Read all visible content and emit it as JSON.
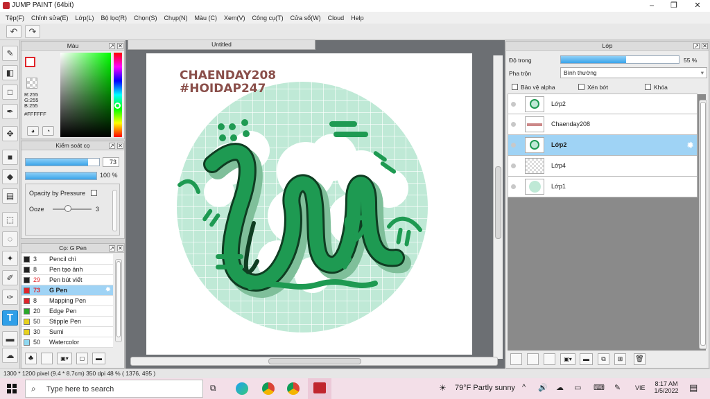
{
  "window": {
    "title": "JUMP PAINT (64bit)",
    "minimize": "–",
    "restore": "❐",
    "close": "✕"
  },
  "menu": [
    "Tệp(F)",
    "Chỉnh sửa(E)",
    "Lớp(L)",
    "Bộ lọc(R)",
    "Chọn(S)",
    "Chụp(N)",
    "Màu (C)",
    "Xem(V)",
    "Công cụ(T)",
    "Cửa sổ(W)",
    "Cloud",
    "Help"
  ],
  "color_panel": {
    "title": "Màu",
    "r": "R:255",
    "g": "G:255",
    "b": "B:255",
    "hex": "#FFFFFF",
    "accent": "#e0252b"
  },
  "brush_control": {
    "title": "Kiểm soát cọ",
    "size_value": "73",
    "opacity_value": "100 %",
    "opacity_by_pressure": "Opacity by Pressure",
    "ooze_label": "Ooze",
    "ooze_value": "3",
    "size_fraction": 0.85,
    "opacity_fraction": 1.0,
    "ooze_fraction": 0.4
  },
  "brush_list": {
    "title": "Cọ: G Pen",
    "items": [
      {
        "size": "3",
        "name": "Pencil chì",
        "color": "#222222",
        "size_color": "#222222"
      },
      {
        "size": "8",
        "name": "Pen tạo ảnh",
        "color": "#222222",
        "size_color": "#222222"
      },
      {
        "size": "29",
        "name": "Pen bút viết",
        "color": "#222222",
        "size_color": "#e0252b"
      },
      {
        "size": "73",
        "name": "G Pen",
        "color": "#e0252b",
        "size_color": "#e0252b",
        "selected": true
      },
      {
        "size": "8",
        "name": "Mapping Pen",
        "color": "#e0252b",
        "size_color": "#222222"
      },
      {
        "size": "20",
        "name": "Edge Pen",
        "color": "#2aa82a",
        "size_color": "#222222"
      },
      {
        "size": "50",
        "name": "Stipple Pen",
        "color": "#e8d21c",
        "size_color": "#222222"
      },
      {
        "size": "30",
        "name": "Sumi",
        "color": "#e8d21c",
        "size_color": "#222222"
      },
      {
        "size": "50",
        "name": "Watercolor",
        "color": "#8fd8f0",
        "size_color": "#222222"
      }
    ]
  },
  "document": {
    "tab_title": "Untitled",
    "artwork_line1": "CHAENDAY208",
    "artwork_line2": "#HOIDAP247",
    "artwork_main": "hu",
    "brand_green": "#1e9a52",
    "mint": "#bfe9d6"
  },
  "layers": {
    "title": "Lớp",
    "opacity_label": "Độ trong",
    "opacity_value": "55 %",
    "opacity_fraction": 0.55,
    "blend_label": "Pha trộn",
    "blend_value": "Bình thường",
    "protect_alpha": "Bảo vệ alpha",
    "clipping": "Xén bớt",
    "lock": "Khóa",
    "items": [
      {
        "name": "Lớp2",
        "thumb": "art"
      },
      {
        "name": "Chaenday208",
        "thumb": "text"
      },
      {
        "name": "Lớp2",
        "thumb": "art",
        "selected": true
      },
      {
        "name": "Lớp4",
        "thumb": "empty"
      },
      {
        "name": "Lớp1",
        "thumb": "circle"
      }
    ]
  },
  "status": {
    "text": "1300 * 1200 pixel  (9.4 * 8.7cm)  350 dpi  48 %  ( 1376, 495 )"
  },
  "taskbar": {
    "search_placeholder": "Type here to search",
    "weather": "79°F  Partly sunny",
    "lang": "VIE",
    "time": "8:17 AM",
    "date": "1/5/2022"
  }
}
